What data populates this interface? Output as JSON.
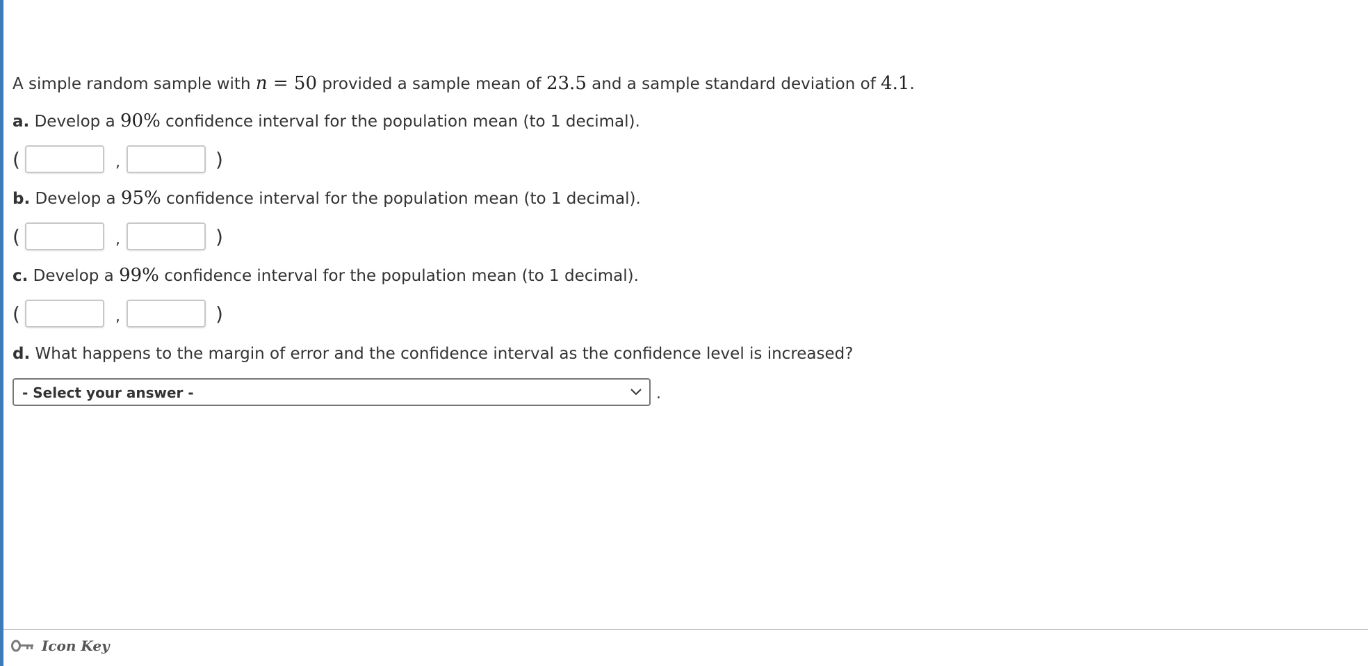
{
  "question": {
    "intro": {
      "text1": "A simple random sample with ",
      "n_var": "n",
      "equals": " = ",
      "n_value": "50",
      "text2": " provided a sample mean of ",
      "mean": "23.5",
      "text3": " and a sample standard deviation of ",
      "sd": "4.1",
      "text4": "."
    },
    "parts": [
      {
        "label": "a.",
        "prefix": " Develop a ",
        "level": "90%",
        "suffix": " confidence interval for the population mean (to 1 decimal).",
        "open_paren": "(",
        "comma": ",",
        "close_paren": ")",
        "lower_value": "",
        "upper_value": ""
      },
      {
        "label": "b.",
        "prefix": " Develop a ",
        "level": "95%",
        "suffix": " confidence interval for the population mean (to 1 decimal).",
        "open_paren": "(",
        "comma": ",",
        "close_paren": ")",
        "lower_value": "",
        "upper_value": ""
      },
      {
        "label": "c.",
        "prefix": " Develop a ",
        "level": "99%",
        "suffix": " confidence interval for the population mean (to 1 decimal).",
        "open_paren": "(",
        "comma": ",",
        "close_paren": ")",
        "lower_value": "",
        "upper_value": ""
      }
    ],
    "part_d": {
      "label": "d.",
      "text": " What happens to the margin of error and the confidence interval as the confidence level is increased?",
      "select_value": "- Select your answer -",
      "trailing": "."
    }
  },
  "footer": {
    "icon": "key-icon",
    "label": "Icon Key"
  },
  "colors": {
    "left_rule": "#3c7ab8",
    "text": "#333333",
    "input_border": "#c8c8c8",
    "select_border": "#777777",
    "footer_rule": "#c8c8c8"
  }
}
